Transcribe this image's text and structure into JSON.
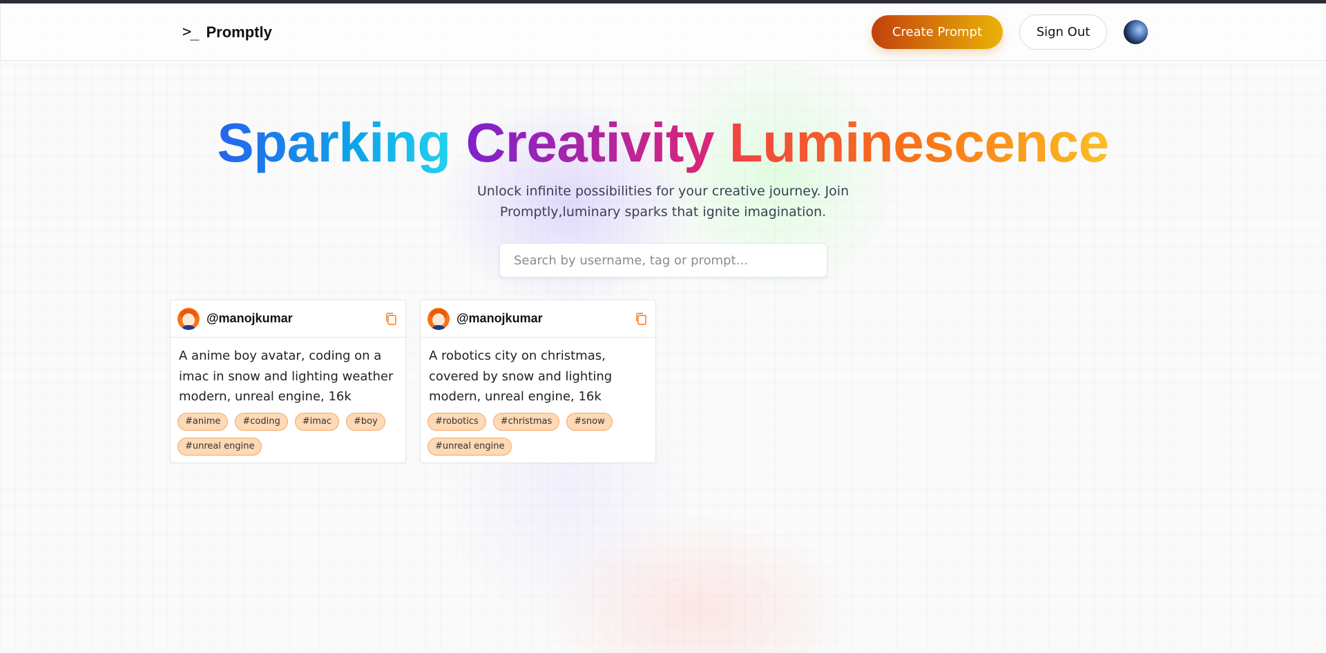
{
  "nav": {
    "logo_icon": ">_",
    "logo_text": "Promptly",
    "create_label": "Create Prompt",
    "signout_label": "Sign Out"
  },
  "hero": {
    "title_part1": "Sparking",
    "title_part2": "Creativity",
    "title_part3": "Luminescence",
    "description_line1": "Unlock infinite possibilities for your creative journey. Join",
    "description_line2": "Promptly,luminary sparks that ignite imagination."
  },
  "search": {
    "placeholder": "Search by username, tag or prompt...",
    "value": ""
  },
  "cards": [
    {
      "username": "@manojkumar",
      "prompt": "A anime boy avatar, coding on a imac in snow and lighting weather modern, unreal engine, 16k",
      "tags": [
        "#anime",
        "#coding",
        "#imac",
        "#boy",
        "#unreal engine"
      ]
    },
    {
      "username": "@manojkumar",
      "prompt": "A robotics city on christmas, covered by snow and lighting modern, unreal engine, 16k",
      "tags": [
        "#robotics",
        "#christmas",
        "#snow",
        "#unreal engine"
      ]
    }
  ],
  "icons": {
    "logo": "terminal-prompt-icon",
    "copy": "copy-icon",
    "user_avatar": "user-avatar",
    "card_avatar": "anime-avatar"
  },
  "colors": {
    "accent_start": "#c2410c",
    "accent_end": "#eab308",
    "tag_bg": "#fdd9b5",
    "tag_border": "#f4a868",
    "copy_icon": "#f97316"
  }
}
